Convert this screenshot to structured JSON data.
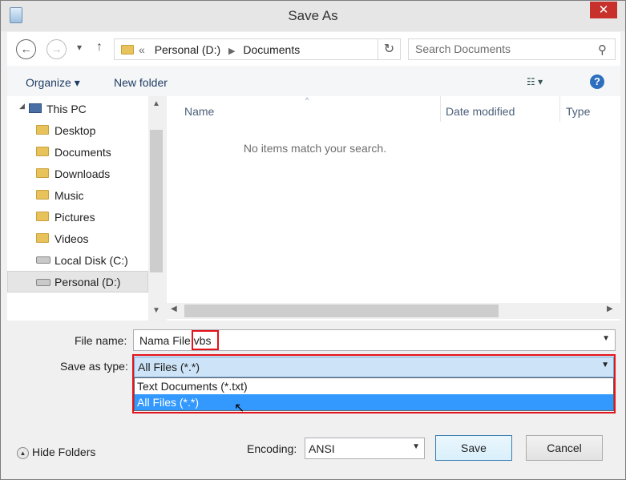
{
  "window": {
    "title": "Save As",
    "close_glyph": "✕"
  },
  "nav": {
    "back_glyph": "←",
    "forward_glyph": "→",
    "recent_glyph": "▾",
    "up_glyph": "↑",
    "breadcrumb": {
      "overflow": "«",
      "items": [
        "Personal (D:)",
        "Documents"
      ],
      "sep": "▶"
    },
    "refresh_glyph": "↻",
    "search_placeholder": "Search Documents",
    "search_glyph": "⚲"
  },
  "toolbar": {
    "organize_label": "Organize ▾",
    "new_folder_label": "New folder",
    "view_glyph": "☷ ▾",
    "help_glyph": "?"
  },
  "tree": {
    "root": "This PC",
    "items": [
      {
        "label": "Desktop"
      },
      {
        "label": "Documents"
      },
      {
        "label": "Downloads"
      },
      {
        "label": "Music"
      },
      {
        "label": "Pictures"
      },
      {
        "label": "Videos"
      },
      {
        "label": "Local Disk (C:)"
      },
      {
        "label": "Personal (D:)"
      }
    ]
  },
  "file_list": {
    "columns": [
      "Name",
      "Date modified",
      "Type"
    ],
    "sort_glyph": "^",
    "empty_message": "No items match your search."
  },
  "form": {
    "file_name_label": "File name:",
    "file_name_value": "Nama File.vbs",
    "save_as_type_label": "Save as type:",
    "save_as_type_value": "All Files  (*.*)",
    "type_options": [
      "Text Documents (*.txt)",
      "All Files  (*.*)"
    ],
    "selected_type_index": 1,
    "dropdown_glyph": "⌄"
  },
  "footer": {
    "hide_folders_label": "Hide Folders",
    "hide_folders_glyph": "▲",
    "encoding_label": "Encoding:",
    "encoding_value": "ANSI",
    "save_label": "Save",
    "cancel_label": "Cancel"
  },
  "colors": {
    "close": "#c7302b",
    "highlight": "#e3121b",
    "selection": "#3399ff",
    "dropdown_bg": "#cde3f7"
  }
}
